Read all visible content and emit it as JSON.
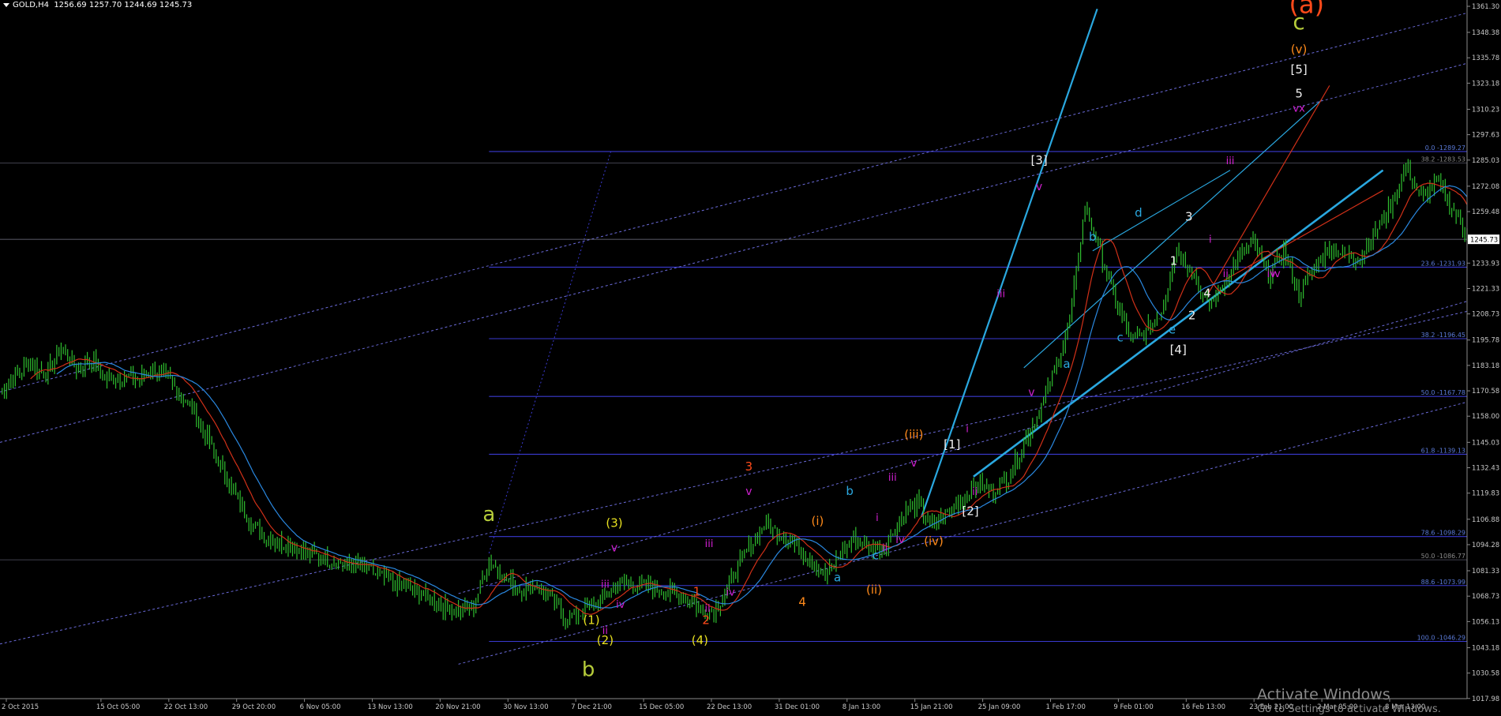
{
  "header": {
    "symbol": "GOLD,H4",
    "ohlc": "1256.69 1257.70 1244.69 1245.73"
  },
  "watermark": {
    "line1": "Activate Windows",
    "line2": "Go to Settings to activate Windows."
  },
  "colors": {
    "background": "#000000",
    "candles": "#2fbf2f",
    "fib_lines": "#3a3ad0",
    "trend_lines": "#2aa8e0",
    "dotted_channel": "#6a6ad8",
    "ma_fast": "#d03018",
    "ma_slow": "#2a88e0",
    "price_axis_text": "#c8c8c8"
  },
  "chart_data": {
    "type": "candlestick",
    "symbol": "GOLD",
    "timeframe": "H4",
    "ylim": [
      1017.9,
      1361.3
    ],
    "y_ticks": [
      1361.3,
      1348.38,
      1335.78,
      1323.18,
      1310.23,
      1297.63,
      1285.03,
      1272.08,
      1259.48,
      1245.73,
      1233.93,
      1221.33,
      1208.73,
      1195.78,
      1183.18,
      1170.58,
      1158.0,
      1145.03,
      1132.43,
      1119.83,
      1106.88,
      1094.28,
      1081.33,
      1068.73,
      1056.13,
      1043.18,
      1030.58,
      1017.98
    ],
    "current_price": 1245.73,
    "x_ticks": [
      "2 Oct 2015",
      "15 Oct 05:00",
      "22 Oct 13:00",
      "29 Oct 20:00",
      "6 Nov 05:00",
      "13 Nov 13:00",
      "20 Nov 21:00",
      "30 Nov 13:00",
      "7 Dec 21:00",
      "15 Dec 05:00",
      "22 Dec 13:00",
      "31 Dec 01:00",
      "8 Jan 13:00",
      "15 Jan 21:00",
      "25 Jan 09:00",
      "1 Feb 17:00",
      "9 Feb 01:00",
      "16 Feb 13:00",
      "23 Feb 21:00",
      "2 Mar 05:00",
      "8 Mar 13:00"
    ],
    "fib_levels": [
      {
        "label": "0.0 -1289.27",
        "value": 1289.27
      },
      {
        "label": "38.2 -1283.53",
        "value": 1283.53
      },
      {
        "label": "23.6 -1231.93",
        "value": 1231.93
      },
      {
        "label": "38.2 -1196.45",
        "value": 1196.45
      },
      {
        "label": "50.0 -1167.78",
        "value": 1167.78
      },
      {
        "label": "61.8 -1139.13",
        "value": 1139.13
      },
      {
        "label": "78.6 -1098.29",
        "value": 1098.29
      },
      {
        "label": "50.0 -1086.77",
        "value": 1086.77
      },
      {
        "label": "88.6 -1073.99",
        "value": 1073.99
      },
      {
        "label": "100.0 -1046.29",
        "value": 1046.29
      }
    ],
    "price_path": [
      [
        0,
        1170
      ],
      [
        2,
        1185
      ],
      [
        3,
        1178
      ],
      [
        4,
        1192
      ],
      [
        5,
        1182
      ],
      [
        6,
        1186
      ],
      [
        7,
        1176
      ],
      [
        8,
        1178
      ],
      [
        9,
        1176
      ],
      [
        10,
        1182
      ],
      [
        11,
        1176
      ],
      [
        12,
        1168
      ],
      [
        13,
        1155
      ],
      [
        14,
        1140
      ],
      [
        15,
        1125
      ],
      [
        16,
        1110
      ],
      [
        17,
        1100
      ],
      [
        18,
        1096
      ],
      [
        19,
        1094
      ],
      [
        20,
        1090
      ],
      [
        21,
        1088
      ],
      [
        22,
        1086
      ],
      [
        23,
        1084
      ],
      [
        24,
        1082
      ],
      [
        25,
        1078
      ],
      [
        26,
        1074
      ],
      [
        27,
        1072
      ],
      [
        28,
        1068
      ],
      [
        29,
        1064
      ],
      [
        30,
        1062
      ],
      [
        31,
        1064
      ],
      [
        32,
        1087
      ],
      [
        33,
        1078
      ],
      [
        34,
        1072
      ],
      [
        35,
        1074
      ],
      [
        36,
        1068
      ],
      [
        37,
        1058
      ],
      [
        38,
        1060
      ],
      [
        39,
        1065
      ],
      [
        40,
        1072
      ],
      [
        41,
        1076
      ],
      [
        42,
        1074
      ],
      [
        43,
        1072
      ],
      [
        44,
        1070
      ],
      [
        45,
        1068
      ],
      [
        46,
        1060
      ],
      [
        47,
        1064
      ],
      [
        48,
        1080
      ],
      [
        49,
        1092
      ],
      [
        50,
        1104
      ],
      [
        51,
        1100
      ],
      [
        52,
        1094
      ],
      [
        53,
        1088
      ],
      [
        54,
        1078
      ],
      [
        55,
        1090
      ],
      [
        56,
        1098
      ],
      [
        57,
        1092
      ],
      [
        58,
        1094
      ],
      [
        59,
        1108
      ],
      [
        60,
        1115
      ],
      [
        61,
        1104
      ],
      [
        62,
        1110
      ],
      [
        63,
        1118
      ],
      [
        64,
        1124
      ],
      [
        65,
        1121
      ],
      [
        66,
        1128
      ],
      [
        67,
        1145
      ],
      [
        68,
        1160
      ],
      [
        69,
        1180
      ],
      [
        70,
        1205
      ],
      [
        71,
        1262
      ],
      [
        72,
        1240
      ],
      [
        73,
        1215
      ],
      [
        74,
        1196
      ],
      [
        75,
        1200
      ],
      [
        76,
        1210
      ],
      [
        77,
        1242
      ],
      [
        78,
        1230
      ],
      [
        79,
        1212
      ],
      [
        80,
        1222
      ],
      [
        81,
        1236
      ],
      [
        82,
        1244
      ],
      [
        83,
        1228
      ],
      [
        84,
        1240
      ],
      [
        85,
        1218
      ],
      [
        86,
        1232
      ],
      [
        87,
        1242
      ],
      [
        88,
        1238
      ],
      [
        89,
        1236
      ],
      [
        90,
        1250
      ],
      [
        91,
        1262
      ],
      [
        92,
        1282
      ],
      [
        93,
        1266
      ],
      [
        94,
        1275
      ],
      [
        95,
        1262
      ],
      [
        96,
        1248
      ]
    ],
    "wave_labels": [
      {
        "text": "a",
        "color": "#b6cc3a",
        "x": 32,
        "y": 1106,
        "size": 26
      },
      {
        "text": "b",
        "color": "#b6cc3a",
        "x": 38.5,
        "y": 1029,
        "size": 26
      },
      {
        "text": "c",
        "color": "#b6cc3a",
        "x": 85,
        "y": 1350,
        "size": 28
      },
      {
        "text": "(a)",
        "color": "#ff4a1a",
        "x": 85.5,
        "y": 1358,
        "size": 32
      },
      {
        "text": "(v)",
        "color": "#ff8a1a",
        "x": 85,
        "y": 1338,
        "size": 15
      },
      {
        "text": "[5]",
        "color": "#f0f0f0",
        "x": 85,
        "y": 1328,
        "size": 15
      },
      {
        "text": "5",
        "color": "#f0f0f0",
        "x": 85,
        "y": 1316,
        "size": 15
      },
      {
        "text": "vx",
        "color": "#d020d0",
        "x": 85,
        "y": 1309,
        "size": 13
      },
      {
        "text": "[3]",
        "color": "#f0f0f0",
        "x": 68,
        "y": 1283,
        "size": 15
      },
      {
        "text": "v",
        "color": "#d020d0",
        "x": 68,
        "y": 1270,
        "size": 14
      },
      {
        "text": "iii",
        "color": "#d020d0",
        "x": 80.5,
        "y": 1283,
        "size": 13
      },
      {
        "text": "d",
        "color": "#2aa8e0",
        "x": 74.5,
        "y": 1257,
        "size": 15
      },
      {
        "text": "b",
        "color": "#2aa8e0",
        "x": 71.5,
        "y": 1245,
        "size": 15
      },
      {
        "text": "3",
        "color": "#f0f0f0",
        "x": 77.8,
        "y": 1255,
        "size": 15
      },
      {
        "text": "1",
        "color": "#f0f0f0",
        "x": 76.8,
        "y": 1233,
        "size": 15
      },
      {
        "text": "i",
        "color": "#d020d0",
        "x": 79.2,
        "y": 1244,
        "size": 13
      },
      {
        "text": "ii",
        "color": "#d020d0",
        "x": 80.2,
        "y": 1227,
        "size": 13
      },
      {
        "text": "iv",
        "color": "#d020d0",
        "x": 83.5,
        "y": 1227,
        "size": 13
      },
      {
        "text": "4",
        "color": "#f0f0f0",
        "x": 79,
        "y": 1217,
        "size": 15
      },
      {
        "text": "2",
        "color": "#f0f0f0",
        "x": 78,
        "y": 1206,
        "size": 15
      },
      {
        "text": "c",
        "color": "#2aa8e0",
        "x": 73.3,
        "y": 1195,
        "size": 15
      },
      {
        "text": "e",
        "color": "#2aa8e0",
        "x": 76.7,
        "y": 1199,
        "size": 15
      },
      {
        "text": "[4]",
        "color": "#f0f0f0",
        "x": 77.1,
        "y": 1189,
        "size": 15
      },
      {
        "text": "a",
        "color": "#2aa8e0",
        "x": 69.8,
        "y": 1182,
        "size": 15
      },
      {
        "text": "iii",
        "color": "#d020d0",
        "x": 65.5,
        "y": 1217,
        "size": 13
      },
      {
        "text": "v",
        "color": "#d020d0",
        "x": 67.5,
        "y": 1168,
        "size": 14
      },
      {
        "text": "i",
        "color": "#d020d0",
        "x": 63.3,
        "y": 1150,
        "size": 13
      },
      {
        "text": "[1]",
        "color": "#f0f0f0",
        "x": 62.3,
        "y": 1142,
        "size": 15
      },
      {
        "text": "ii",
        "color": "#d020d0",
        "x": 63.8,
        "y": 1119,
        "size": 13
      },
      {
        "text": "[2]",
        "color": "#f0f0f0",
        "x": 63.5,
        "y": 1109,
        "size": 15
      },
      {
        "text": "(iii)",
        "color": "#ff8a1a",
        "x": 59.8,
        "y": 1147,
        "size": 15
      },
      {
        "text": "v",
        "color": "#d020d0",
        "x": 59.8,
        "y": 1133,
        "size": 14
      },
      {
        "text": "iii",
        "color": "#d020d0",
        "x": 58.4,
        "y": 1126,
        "size": 13
      },
      {
        "text": "b",
        "color": "#2aa8e0",
        "x": 55.6,
        "y": 1119,
        "size": 15
      },
      {
        "text": "i",
        "color": "#d020d0",
        "x": 57.4,
        "y": 1106,
        "size": 13
      },
      {
        "text": "ii",
        "color": "#d020d0",
        "x": 57.9,
        "y": 1091,
        "size": 13
      },
      {
        "text": "iv",
        "color": "#d020d0",
        "x": 58.9,
        "y": 1095,
        "size": 13
      },
      {
        "text": "c",
        "color": "#2aa8e0",
        "x": 57.3,
        "y": 1087,
        "size": 15
      },
      {
        "text": "(iv)",
        "color": "#ff8a1a",
        "x": 61.1,
        "y": 1094,
        "size": 15
      },
      {
        "text": "(i)",
        "color": "#ff8a1a",
        "x": 53.5,
        "y": 1104,
        "size": 15
      },
      {
        "text": "a",
        "color": "#2aa8e0",
        "x": 54.8,
        "y": 1076,
        "size": 15
      },
      {
        "text": "(ii)",
        "color": "#ff8a1a",
        "x": 57.2,
        "y": 1070,
        "size": 15
      },
      {
        "text": "4",
        "color": "#ff8a1a",
        "x": 52.5,
        "y": 1064,
        "size": 15
      },
      {
        "text": "3",
        "color": "#ff4a1a",
        "x": 49,
        "y": 1131,
        "size": 15
      },
      {
        "text": "v",
        "color": "#d020d0",
        "x": 49,
        "y": 1119,
        "size": 14
      },
      {
        "text": "iii",
        "color": "#d020d0",
        "x": 46.4,
        "y": 1093,
        "size": 13
      },
      {
        "text": "iv",
        "color": "#d020d0",
        "x": 47.8,
        "y": 1069,
        "size": 13
      },
      {
        "text": "1",
        "color": "#ff4a1a",
        "x": 45.6,
        "y": 1069,
        "size": 15
      },
      {
        "text": "ii",
        "color": "#d020d0",
        "x": 46.3,
        "y": 1061,
        "size": 13
      },
      {
        "text": "2",
        "color": "#ff4a1a",
        "x": 46.2,
        "y": 1055,
        "size": 15
      },
      {
        "text": "(4)",
        "color": "#e8e020",
        "x": 45.8,
        "y": 1045,
        "size": 15
      },
      {
        "text": "(3)",
        "color": "#e8e020",
        "x": 40.2,
        "y": 1103,
        "size": 15
      },
      {
        "text": "v",
        "color": "#d020d0",
        "x": 40.2,
        "y": 1091,
        "size": 14
      },
      {
        "text": "iii",
        "color": "#d020d0",
        "x": 39.6,
        "y": 1073,
        "size": 13
      },
      {
        "text": "iv",
        "color": "#d020d0",
        "x": 40.6,
        "y": 1063,
        "size": 13
      },
      {
        "text": "ii",
        "color": "#d020d0",
        "x": 39.6,
        "y": 1050,
        "size": 13
      },
      {
        "text": "(1)",
        "color": "#e8e020",
        "x": 38.7,
        "y": 1055,
        "size": 15
      },
      {
        "text": "(2)",
        "color": "#e8e020",
        "x": 39.6,
        "y": 1045,
        "size": 15
      },
      {
        "text": "iv",
        "color": "#d020d0",
        "x": 83.2,
        "y": 1227,
        "size": 13
      }
    ]
  }
}
